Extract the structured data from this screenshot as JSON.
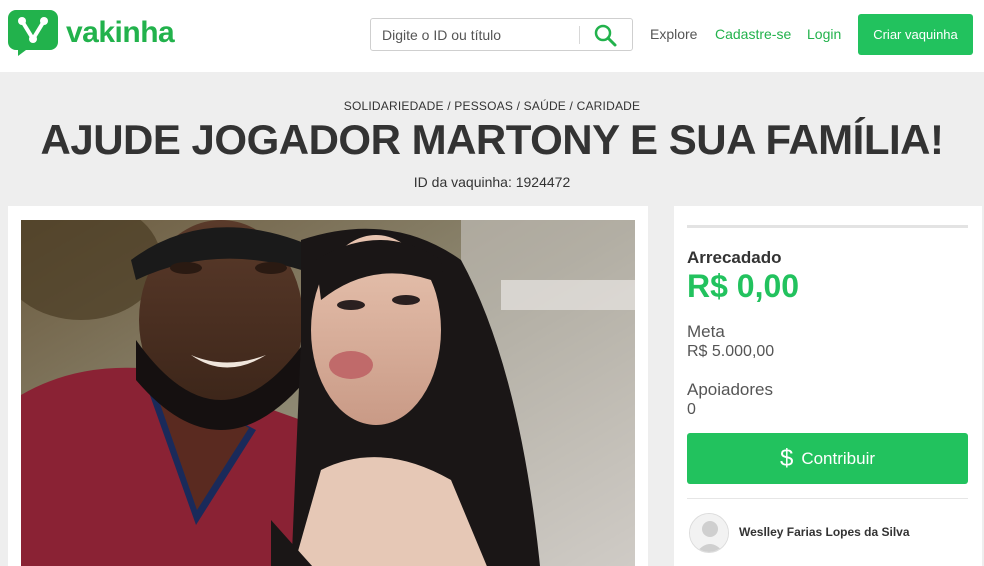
{
  "brand": {
    "name": "vakinha",
    "color": "#22b24c",
    "logo_icon": "vakinha-logo-icon"
  },
  "search": {
    "placeholder": "Digite o ID ou título",
    "icon": "search-icon"
  },
  "nav": {
    "explore": "Explore",
    "signup": "Cadastre-se",
    "login": "Login",
    "create": "Criar vaquinha"
  },
  "campaign": {
    "categories": "SOLIDARIEDADE / PESSOAS / SAÚDE / CARIDADE",
    "title": "AJUDE JOGADOR MARTONY E SUA FAMÍLIA!",
    "id_text": "ID da vaquinha: 1924472",
    "photo": "selfie-photo"
  },
  "stats": {
    "progress_fraction": 0,
    "raised_label": "Arrecadado",
    "raised_value": "R$ 0,00",
    "goal_label": "Meta",
    "goal_value": "R$ 5.000,00",
    "supporters_label": "Apoiadores",
    "supporters_value": "0"
  },
  "cta": {
    "dollar": "$",
    "label": "Contribuir"
  },
  "owner": {
    "name": "Weslley Farias Lopes da Silva",
    "avatar_icon": "user-avatar-icon"
  },
  "colors": {
    "accent": "#22c25e",
    "band": "#eeeeee",
    "text": "#333333"
  }
}
